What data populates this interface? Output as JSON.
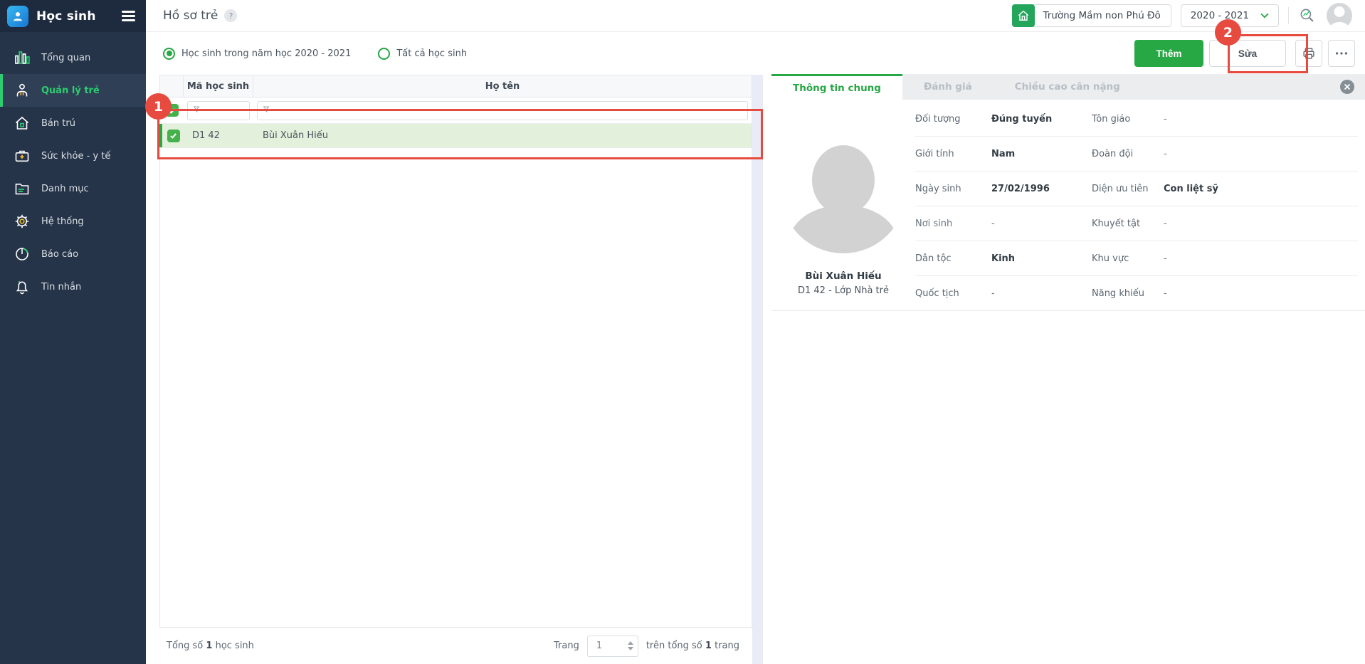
{
  "colors": {
    "primary_green": "#28a745",
    "sidebar_accent_green": "#2ecc71",
    "sidebar_bg": "#263449",
    "selected_row_green": "#e3f0db",
    "annotation_red": "#e74a3f",
    "logo_blue": "#2196f3"
  },
  "icons": {
    "app_logo": "person-icon",
    "menu_toggle": "hamburger-icon",
    "school": "house-icon",
    "year_dropdown": "chevron-down-icon",
    "search": "magnifier-chart-icon",
    "user": "avatar-icon",
    "print": "printer-icon",
    "more": "ellipsis-icon",
    "filter": "funnel-icon",
    "close": "x-circle-icon",
    "help": "question-mark-badge"
  },
  "app": {
    "title": "Học sinh"
  },
  "sidebar": {
    "items": [
      {
        "label": "Tổng quan",
        "icon": "bar-chart-icon",
        "active": false
      },
      {
        "label": "Quản lý trẻ",
        "icon": "child-person-icon",
        "active": true
      },
      {
        "label": "Bán trú",
        "icon": "house-icon",
        "active": false
      },
      {
        "label": "Sức khỏe - y tế",
        "icon": "medkit-icon",
        "active": false
      },
      {
        "label": "Danh mục",
        "icon": "folder-icon",
        "active": false
      },
      {
        "label": "Hệ thống",
        "icon": "gear-icon",
        "active": false
      },
      {
        "label": "Báo cáo",
        "icon": "pie-chart-icon",
        "active": false
      },
      {
        "label": "Tin nhắn",
        "icon": "bell-icon",
        "active": false
      }
    ]
  },
  "topbar": {
    "page_title": "Hồ sơ trẻ",
    "help_badge": "?",
    "school_name": "Trường Mầm non Phú Đô",
    "school_year": "2020 - 2021"
  },
  "filters": {
    "by_year_label": "Học sinh trong năm học 2020 - 2021",
    "all_label": "Tất cả học sinh",
    "selected": "by_year"
  },
  "toolbar": {
    "add_label": "Thêm",
    "edit_label": "Sửa"
  },
  "table": {
    "headers": {
      "code": "Mã học sinh",
      "name": "Họ tên"
    },
    "rows": [
      {
        "code": "D1 42",
        "name": "Bùi Xuân Hiếu",
        "selected": true
      }
    ]
  },
  "footer": {
    "total_prefix": "Tổng số",
    "total_count": "1",
    "total_suffix": "học sinh",
    "page_label": "Trang",
    "page_value": "1",
    "pages_prefix": "trên tổng số",
    "pages_count": "1",
    "pages_suffix": "trang"
  },
  "detail": {
    "tabs": [
      {
        "label": "Thông tin chung",
        "active": true
      },
      {
        "label": "Đánh giá",
        "active": false
      },
      {
        "label": "Chiều cao cân nặng",
        "active": false
      }
    ],
    "student": {
      "name": "Bùi Xuân Hiếu",
      "class_info": "D1 42 - Lớp Nhà trẻ"
    },
    "fields": [
      {
        "label1": "Đối tượng",
        "value1": "Đúng tuyến",
        "label2": "Tôn giáo",
        "value2": "-"
      },
      {
        "label1": "Giới tính",
        "value1": "Nam",
        "label2": "Đoàn đội",
        "value2": "-"
      },
      {
        "label1": "Ngày sinh",
        "value1": "27/02/1996",
        "label2": "Diện ưu tiên",
        "value2": "Con liệt sỹ"
      },
      {
        "label1": "Nơi sinh",
        "value1": "-",
        "label2": "Khuyết tật",
        "value2": "-"
      },
      {
        "label1": "Dân tộc",
        "value1": "Kinh",
        "label2": "Khu vực",
        "value2": "-"
      },
      {
        "label1": "Quốc tịch",
        "value1": "-",
        "label2": "Năng khiếu",
        "value2": "-"
      }
    ]
  },
  "annotations": {
    "step_1": "1",
    "step_2": "2"
  }
}
